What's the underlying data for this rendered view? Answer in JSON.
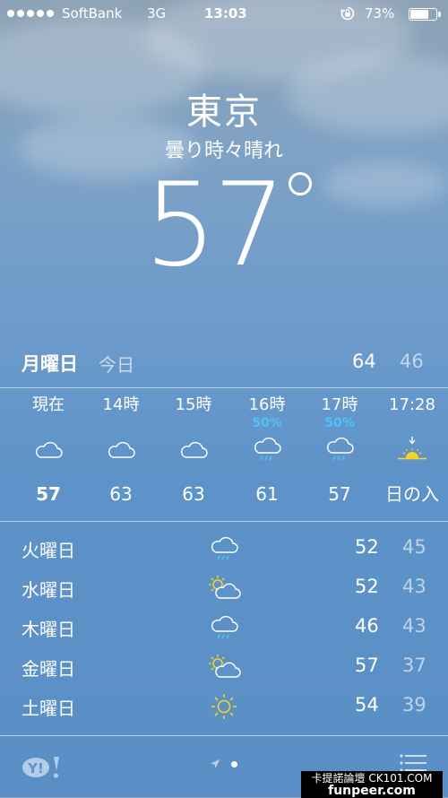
{
  "status_bar": {
    "carrier": "SoftBank",
    "network": "3G",
    "time": "13:03",
    "battery_pct": "73%",
    "battery_level": 0.73,
    "signal_dots": 5,
    "icons": [
      "signal-dots-icon",
      "orientation-lock-icon",
      "battery-icon"
    ]
  },
  "location": {
    "city": "東京",
    "condition": "曇り時々晴れ",
    "temperature": "57",
    "degree_symbol": "°"
  },
  "today": {
    "day": "月曜日",
    "label": "今日",
    "high": "64",
    "low": "46"
  },
  "hourly": [
    {
      "time": "現在",
      "precip": "",
      "icon": "cloud-icon",
      "temp": "57"
    },
    {
      "time": "14時",
      "precip": "",
      "icon": "cloud-icon",
      "temp": "63"
    },
    {
      "time": "15時",
      "precip": "",
      "icon": "cloud-icon",
      "temp": "63"
    },
    {
      "time": "16時",
      "precip": "50%",
      "icon": "cloud-rain-icon",
      "temp": "61"
    },
    {
      "time": "17時",
      "precip": "50%",
      "icon": "cloud-rain-icon",
      "temp": "57"
    },
    {
      "time": "17:28",
      "precip": "",
      "icon": "sunset-icon",
      "temp": "日の入"
    }
  ],
  "daily": [
    {
      "day": "火曜日",
      "icon": "cloud-rain-icon",
      "high": "52",
      "low": "45"
    },
    {
      "day": "水曜日",
      "icon": "partly-sunny-icon",
      "high": "52",
      "low": "43"
    },
    {
      "day": "木曜日",
      "icon": "cloud-rain-icon",
      "high": "46",
      "low": "43"
    },
    {
      "day": "金曜日",
      "icon": "partly-sunny-icon",
      "high": "57",
      "low": "37"
    },
    {
      "day": "土曜日",
      "icon": "sun-icon",
      "high": "54",
      "low": "39"
    }
  ],
  "footer": {
    "logo": "Y!",
    "page_count": 1,
    "watermark_line1": "卡提諾論壇 CK101.COM",
    "watermark_line2": "funpeer.com",
    "icons": [
      "yahoo-logo-icon",
      "location-arrow-icon",
      "page-dot-icon",
      "list-icon"
    ]
  },
  "colors": {
    "precip_blue": "#4fc3f7",
    "sun_yellow": "#f5d327",
    "rain_blue": "#4fc3f7"
  }
}
